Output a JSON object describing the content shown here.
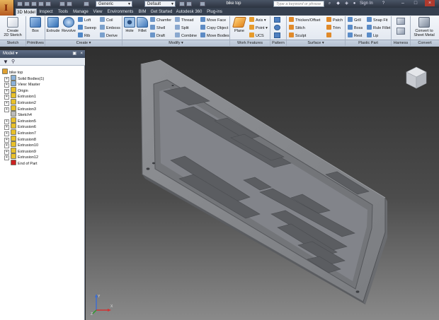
{
  "title_bar": {
    "material_combo": "Generic",
    "appearance_combo": "Default",
    "document_title": "bike top",
    "search_placeholder": "Type a keyword or phrase",
    "sign_in": "Sign In"
  },
  "tabs": [
    "3D Model",
    "Inspect",
    "Tools",
    "Manage",
    "View",
    "Environments",
    "BIM",
    "Get Started",
    "Autodesk 360",
    "Plug-ins"
  ],
  "ribbon": {
    "sketch": {
      "create_sketch": "Create\n2D Sketch",
      "label": "Sketch"
    },
    "primitives": {
      "box": "Box",
      "label": "Primitives"
    },
    "create": {
      "extrude": "Extrude",
      "revolve": "Revolve",
      "loft": "Loft",
      "sweep": "Sweep",
      "rib": "Rib",
      "coil": "Coil",
      "emboss": "Emboss",
      "derive": "Derive",
      "label": "Create ▾"
    },
    "modify": {
      "hole": "Hole",
      "fillet": "Fillet",
      "chamfer": "Chamfer",
      "shell": "Shell",
      "draft": "Draft",
      "thread": "Thread",
      "split": "Split",
      "combine": "Combine",
      "move_face": "Move Face",
      "copy_object": "Copy Object",
      "move_bodies": "Move Bodies",
      "label": "Modify ▾"
    },
    "work_features": {
      "plane": "Plane",
      "axis": "Axis ▾",
      "point": "Point ▾",
      "ucs": "UCS",
      "label": "Work Features"
    },
    "pattern": {
      "label": "Pattern"
    },
    "surface": {
      "thicken": "Thicken/Offset",
      "stitch": "Stitch",
      "sculpt": "Sculpt",
      "patch": "Patch",
      "trim": "Trim",
      "label": "Surface ▾"
    },
    "plastic_part": {
      "grill": "Grill",
      "boss": "Boss",
      "rest": "Rest",
      "snap_fit": "Snap Fit",
      "rule_fillet": "Rule Fillet",
      "lip": "Lip",
      "label": "Plastic Part"
    },
    "harness": {
      "label": "Harness"
    },
    "convert": {
      "convert_sheet_metal": "Convert to\nSheet Metal",
      "label": "Convert"
    }
  },
  "browser": {
    "header": "Model ▾",
    "items": [
      {
        "label": "bike top",
        "level": 0,
        "expander": ""
      },
      {
        "label": "Solid Bodies(1)",
        "level": 1,
        "expander": "+"
      },
      {
        "label": "View: Master",
        "level": 1,
        "expander": "+"
      },
      {
        "label": "Origin",
        "level": 1,
        "expander": "+"
      },
      {
        "label": "Extrusion1",
        "level": 1,
        "expander": "+"
      },
      {
        "label": "Extrusion2",
        "level": 1,
        "expander": "+"
      },
      {
        "label": "Extrusion3",
        "level": 1,
        "expander": "+"
      },
      {
        "label": "Sketch4",
        "level": 1,
        "expander": ""
      },
      {
        "label": "Extrusion5",
        "level": 1,
        "expander": "+"
      },
      {
        "label": "Extrusion6",
        "level": 1,
        "expander": "+"
      },
      {
        "label": "Extrusion7",
        "level": 1,
        "expander": "+"
      },
      {
        "label": "Extrusion8",
        "level": 1,
        "expander": "+"
      },
      {
        "label": "Extrusion10",
        "level": 1,
        "expander": "+"
      },
      {
        "label": "Extrusion9",
        "level": 1,
        "expander": "+"
      },
      {
        "label": "Extrusion12",
        "level": 1,
        "expander": "+"
      },
      {
        "label": "End of Part",
        "level": 1,
        "expander": ""
      }
    ]
  },
  "triad": {
    "x": "X",
    "y": "Y",
    "z": "Z"
  },
  "colors": {
    "ribbon": "#e9edf3",
    "title_bar": "#2c3340",
    "part_gray": "#8a8c90",
    "viewport_top": "#2f2f2f",
    "viewport_bottom": "#8a8a8a",
    "end_of_part": "#c22"
  }
}
